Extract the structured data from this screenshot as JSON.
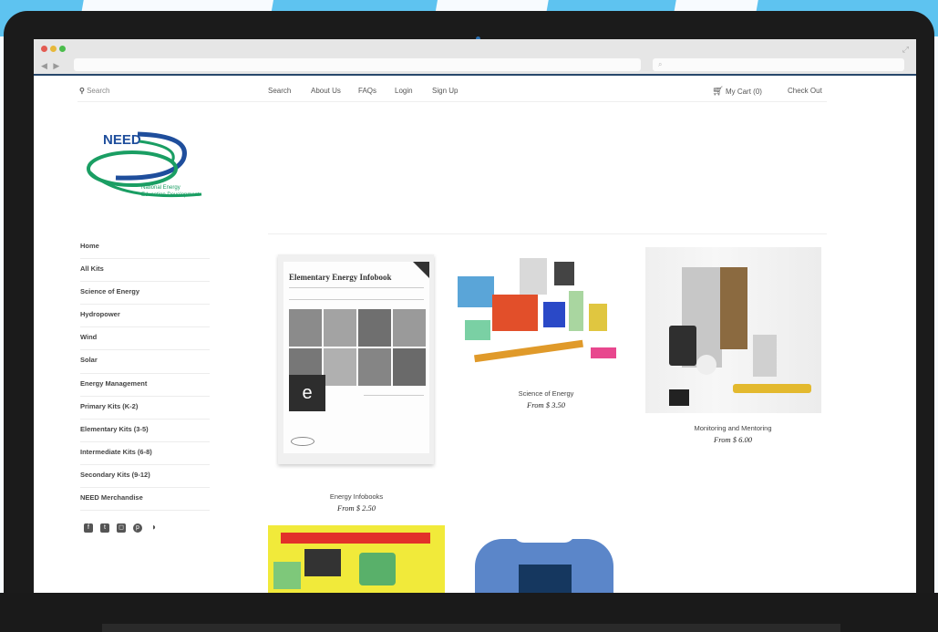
{
  "browser": {
    "nav_buttons": "◀ ▶",
    "search_icon": "magnifier-icon",
    "url_icon": "info-icon"
  },
  "topnav": {
    "search_placeholder": "Search",
    "links": [
      "Search",
      "About Us",
      "FAQs",
      "Login",
      "Sign Up"
    ],
    "cart_label": "My Cart (0)",
    "checkout_label": "Check Out"
  },
  "logo": {
    "brand": "NEED",
    "subtitle_line1": "National Energy",
    "subtitle_line2": "Education Development"
  },
  "sidebar": {
    "items": [
      {
        "label": "Home"
      },
      {
        "label": "All Kits"
      },
      {
        "label": "Science of Energy"
      },
      {
        "label": "Hydropower"
      },
      {
        "label": "Wind"
      },
      {
        "label": "Solar"
      },
      {
        "label": "Energy Management"
      },
      {
        "label": "Primary Kits (K-2)"
      },
      {
        "label": "Elementary Kits (3-5)"
      },
      {
        "label": "Intermediate Kits (6-8)"
      },
      {
        "label": "Secondary Kits (9-12)"
      },
      {
        "label": "NEED Merchandise"
      }
    ],
    "social_icons": [
      "facebook-icon",
      "twitter-icon",
      "instagram-icon",
      "pinterest-icon",
      "rss-icon"
    ]
  },
  "products": [
    {
      "name": "Energy Infobooks",
      "price": "From $ 2.50",
      "book_title": "Elementary Energy Infobook"
    },
    {
      "name": "Science of Energy",
      "price": "From $ 3.50"
    },
    {
      "name": "Monitoring and Mentoring",
      "price": "From $ 6.00"
    }
  ],
  "colors": {
    "brand_blue": "#1f4e9c",
    "brand_green": "#1a9e63",
    "accent_teal": "#5ec3f0",
    "laptop_frame": "#1b1b1b"
  }
}
